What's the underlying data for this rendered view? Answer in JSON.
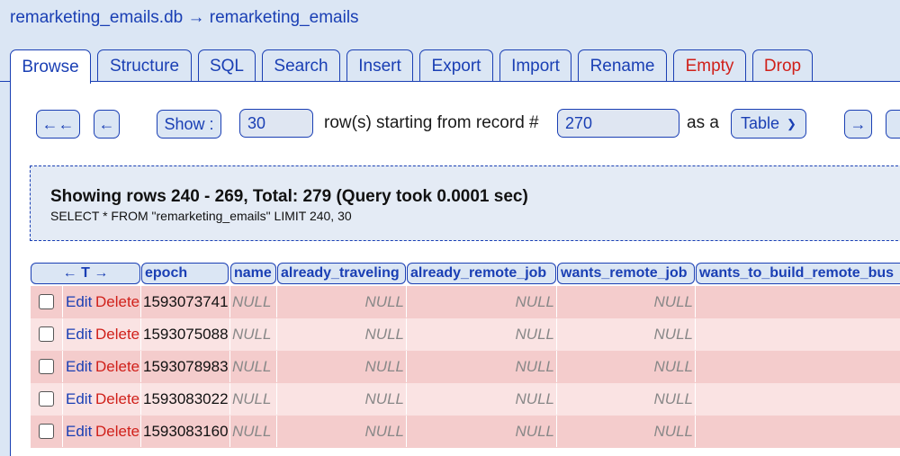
{
  "breadcrumb": {
    "db": "remarketing_emails.db",
    "arrow": "→",
    "table": "remarketing_emails"
  },
  "tabs": [
    "Browse",
    "Structure",
    "SQL",
    "Search",
    "Insert",
    "Export",
    "Import",
    "Rename",
    "Empty",
    "Drop"
  ],
  "toolbar": {
    "first_label": "←←",
    "prev_label": "←",
    "show_label": "Show :",
    "show_value": "30",
    "rows_text": "row(s) starting from record #",
    "start_value": "270",
    "as_text": "as a",
    "view_select": "Table",
    "next_label": "→"
  },
  "info": {
    "heading": "Showing rows 240 - 269, Total: 279 (Query took 0.0001 sec)",
    "query": "SELECT * FROM \"remarketing_emails\" LIMIT 240, 30"
  },
  "columns": {
    "sort": "← T →",
    "epoch": "epoch",
    "name": "name",
    "already_traveling": "already_traveling",
    "already_remote_job": "already_remote_job",
    "wants_remote_job": "wants_remote_job",
    "wants_to_build": "wants_to_build_remote_bus"
  },
  "actions": {
    "edit": "Edit",
    "delete": "Delete"
  },
  "rows": [
    {
      "epoch": "1593073741",
      "name": "NULL",
      "already_traveling": "NULL",
      "already_remote_job": "NULL",
      "wants_remote_job": "NULL"
    },
    {
      "epoch": "1593075088",
      "name": "NULL",
      "already_traveling": "NULL",
      "already_remote_job": "NULL",
      "wants_remote_job": "NULL"
    },
    {
      "epoch": "1593078983",
      "name": "NULL",
      "already_traveling": "NULL",
      "already_remote_job": "NULL",
      "wants_remote_job": "NULL"
    },
    {
      "epoch": "1593083022",
      "name": "NULL",
      "already_traveling": "NULL",
      "already_remote_job": "NULL",
      "wants_remote_job": "NULL"
    },
    {
      "epoch": "1593083160",
      "name": "NULL",
      "already_traveling": "NULL",
      "already_remote_job": "NULL",
      "wants_remote_job": "NULL"
    }
  ],
  "colors": {
    "link": "#1a3fb4",
    "danger": "#d0201a",
    "row_odd": "#f4cccc",
    "row_even": "#fae3e3",
    "background": "#dbe6f4"
  }
}
